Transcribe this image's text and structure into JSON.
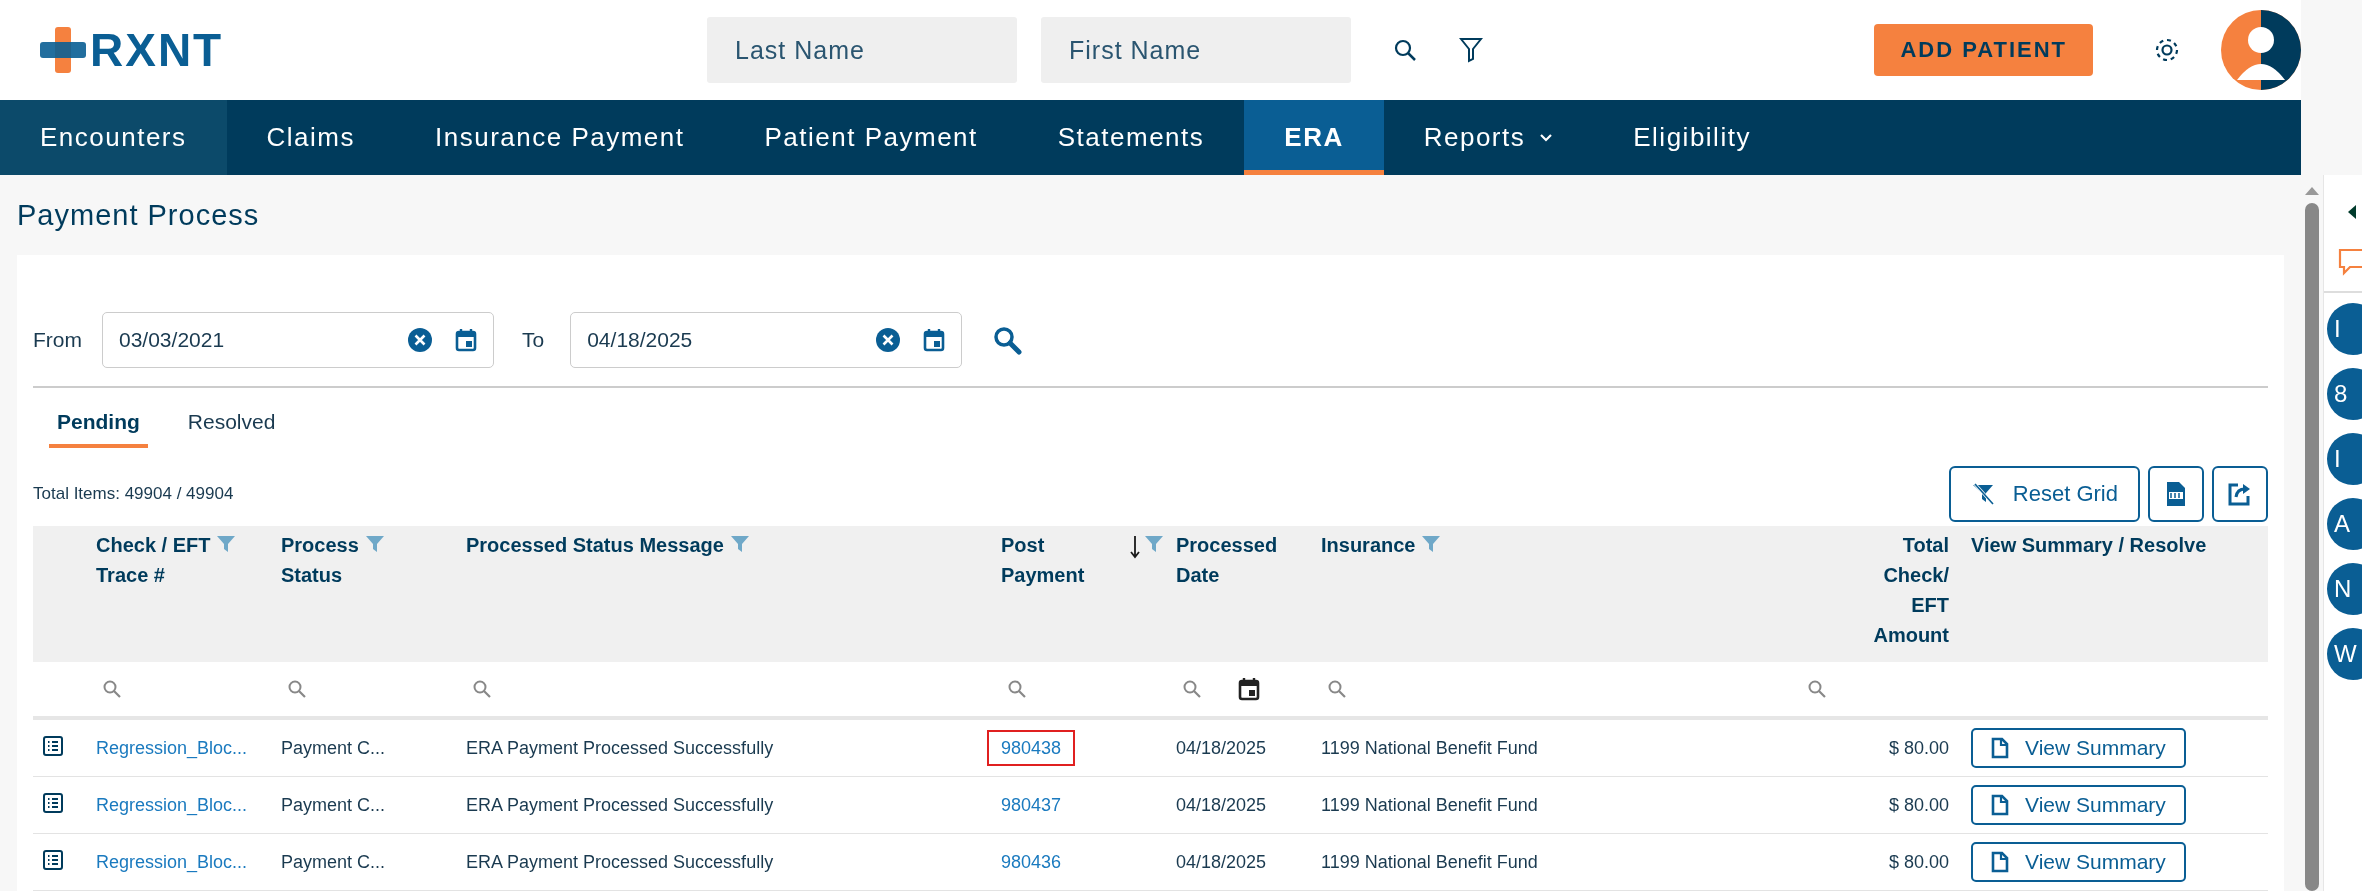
{
  "header": {
    "logo": "RXNT",
    "last_name": {
      "placeholder": "Last Name"
    },
    "first_name": {
      "placeholder": "First Name"
    },
    "add_button": "ADD PATIENT"
  },
  "nav": [
    {
      "label": "Encounters",
      "selected": false,
      "dropdown": false
    },
    {
      "label": "Claims",
      "selected": false,
      "dropdown": false
    },
    {
      "label": "Insurance Payment",
      "selected": false,
      "dropdown": false
    },
    {
      "label": "Patient Payment",
      "selected": false,
      "dropdown": false
    },
    {
      "label": "Statements",
      "selected": false,
      "dropdown": false
    },
    {
      "label": "ERA",
      "selected": true,
      "dropdown": false
    },
    {
      "label": "Reports",
      "selected": false,
      "dropdown": true
    },
    {
      "label": "Eligibility",
      "selected": false,
      "dropdown": false
    }
  ],
  "page_title": "Payment Process",
  "filters": {
    "from_label": "From",
    "from_value": "03/03/2021",
    "to_label": "To",
    "to_value": "04/18/2025"
  },
  "tabs": [
    {
      "label": "Pending",
      "selected": true
    },
    {
      "label": "Resolved",
      "selected": false
    }
  ],
  "total_items": "Total Items: 49904 / 49904",
  "toolbar": {
    "reset_button": "Reset Grid"
  },
  "table": {
    "columns": [
      {
        "kind": "icon"
      },
      {
        "kind": "text",
        "label": "Check / EFT\nTrace #",
        "filter": true,
        "sorted": false
      },
      {
        "kind": "text",
        "label": "Process\nStatus",
        "filter": true,
        "sorted": false
      },
      {
        "kind": "text",
        "label": "Processed Status Message",
        "filter": true,
        "sorted": false
      },
      {
        "kind": "text",
        "label": "Post\nPayment",
        "filter": true,
        "sorted": true
      },
      {
        "kind": "date",
        "label": "Processed\nDate",
        "filter": false,
        "sorted": false
      },
      {
        "kind": "text",
        "label": "Insurance",
        "filter": true,
        "sorted": false
      },
      {
        "kind": "amount",
        "label": "Total\nCheck/\nEFT\nAmount",
        "filter": false,
        "sorted": false
      },
      {
        "kind": "action",
        "label": "View Summary / Resolve",
        "filter": false,
        "sorted": false
      }
    ],
    "rows": [
      {
        "trace": "Regression_Bloc...",
        "status": "Payment C...",
        "message": "ERA Payment Processed Successfully",
        "post_payment": "980438",
        "highlighted": true,
        "date": "04/18/2025",
        "insurance": "1199 National Benefit Fund",
        "amount": "$ 80.00",
        "action": "View Summary"
      },
      {
        "trace": "Regression_Bloc...",
        "status": "Payment C...",
        "message": "ERA Payment Processed Successfully",
        "post_payment": "980437",
        "highlighted": false,
        "date": "04/18/2025",
        "insurance": "1199 National Benefit Fund",
        "amount": "$ 80.00",
        "action": "View Summary"
      },
      {
        "trace": "Regression_Bloc...",
        "status": "Payment C...",
        "message": "ERA Payment Processed Successfully",
        "post_payment": "980436",
        "highlighted": false,
        "date": "04/18/2025",
        "insurance": "1199 National Benefit Fund",
        "amount": "$ 80.00",
        "action": "View Summary"
      }
    ]
  },
  "side_panel": {
    "circles": [
      "I",
      "8",
      "I",
      "A",
      "N",
      "W"
    ]
  }
}
